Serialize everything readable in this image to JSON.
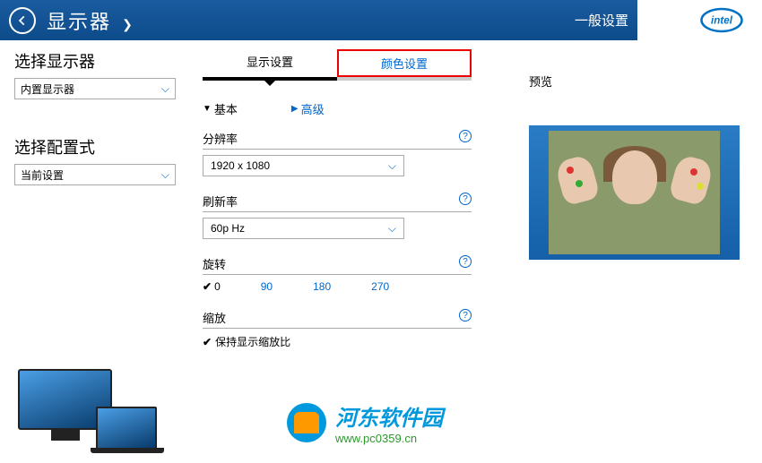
{
  "header": {
    "title": "显示器",
    "general_settings": "一般设置",
    "logo": "intel"
  },
  "sidebar": {
    "select_display_label": "选择显示器",
    "select_display_value": "内置显示器",
    "select_config_label": "选择配置式",
    "select_config_value": "当前设置"
  },
  "tabs": {
    "display_settings": "显示设置",
    "color_settings": "颜色设置"
  },
  "modes": {
    "basic": "基本",
    "advanced": "高级"
  },
  "fields": {
    "resolution": {
      "label": "分辨率",
      "value": "1920 x 1080"
    },
    "refresh": {
      "label": "刷新率",
      "value": "60p Hz"
    },
    "rotation": {
      "label": "旋转",
      "options": [
        "0",
        "90",
        "180",
        "270"
      ],
      "selected": "0"
    },
    "scaling": {
      "label": "缩放",
      "keep_ratio": "保持显示缩放比"
    }
  },
  "preview": {
    "label": "预览"
  },
  "watermark": {
    "title": "河东软件园",
    "url": "www.pc0359.cn"
  }
}
